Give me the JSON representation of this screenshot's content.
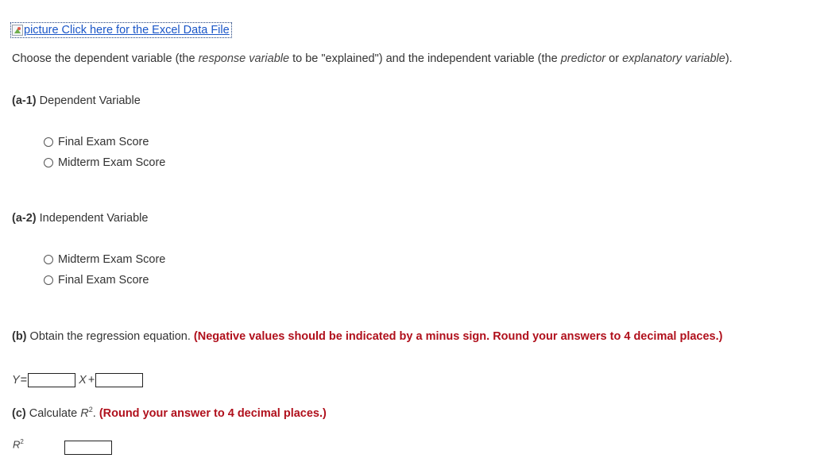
{
  "excel_link": {
    "text": "picture Click here for the Excel Data File"
  },
  "intro": {
    "part1": "Choose the dependent variable (the ",
    "response_variable": "response variable",
    "part2": " to be \"explained\") and the independent variable (the ",
    "predictor": "predictor",
    "part3": " or ",
    "explanatory_variable": "explanatory variable",
    "part4": ")."
  },
  "a1": {
    "label": "(a-1)",
    "title": "Dependent Variable",
    "options": [
      "Final Exam Score",
      "Midterm Exam Score"
    ]
  },
  "a2": {
    "label": "(a-2)",
    "title": "Independent Variable",
    "options": [
      "Midterm Exam Score",
      "Final Exam Score"
    ]
  },
  "b": {
    "label": "(b)",
    "text": "Obtain the regression equation.",
    "instruction": "(Negative values should be indicated by a minus sign. Round your answers to 4 decimal places.)",
    "y_label": "Y",
    "equals": "=",
    "x_label": "X",
    "plus": "+",
    "slope_value": "",
    "intercept_value": ""
  },
  "c": {
    "label": "(c)",
    "text": "Calculate",
    "r_symbol": "R",
    "r_exponent": "2",
    "period": ".",
    "instruction": "(Round your answer to 4 decimal places.)",
    "answer_label_r": "R",
    "answer_label_exp": "2",
    "answer_value": ""
  }
}
